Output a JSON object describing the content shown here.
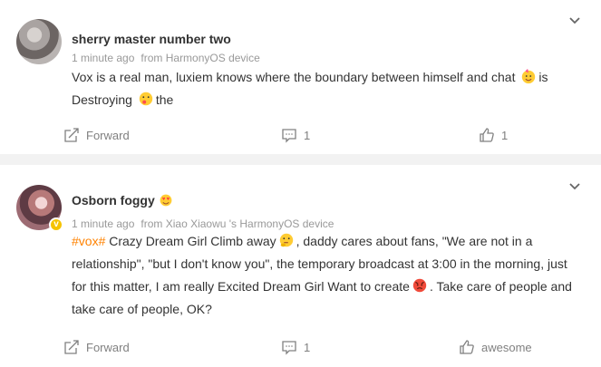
{
  "posts": [
    {
      "user": "sherry master number two",
      "time": "1 minute ago",
      "source": "from HarmonyOS device",
      "text_line1": "Vox is a real man, luxiem knows where the boundary between himself and chat",
      "text_line1_tail": "is",
      "text_line2_a": "Destroying",
      "text_line2_b": "the",
      "forward_label": "Forward",
      "comments": "1",
      "likes": "1"
    },
    {
      "user": "Osborn foggy",
      "time": "1 minute ago",
      "source": "from Xiao Xiaowu 's HarmonyOS device",
      "topic": "#vox#",
      "text_a": " Crazy Dream Girl Climb away",
      "text_b": ", daddy cares about fans, \"We are not in a relationship\", \"but I don't know you\", the temporary broadcast at 3:00 in the morning, just for this matter, I am really Excited Dream Girl Want to create",
      "text_c": ". Take care of people and take care of people, OK?",
      "forward_label": "Forward",
      "comments": "1",
      "likes": "awesome",
      "verified_badge": "v"
    }
  ],
  "icons": {
    "chevron": "chevron-down-icon",
    "forward": "share-icon",
    "comment": "comment-icon",
    "like": "thumbs-up-icon"
  },
  "colors": {
    "topic": "#ff8200",
    "badge": "#f5c300"
  }
}
